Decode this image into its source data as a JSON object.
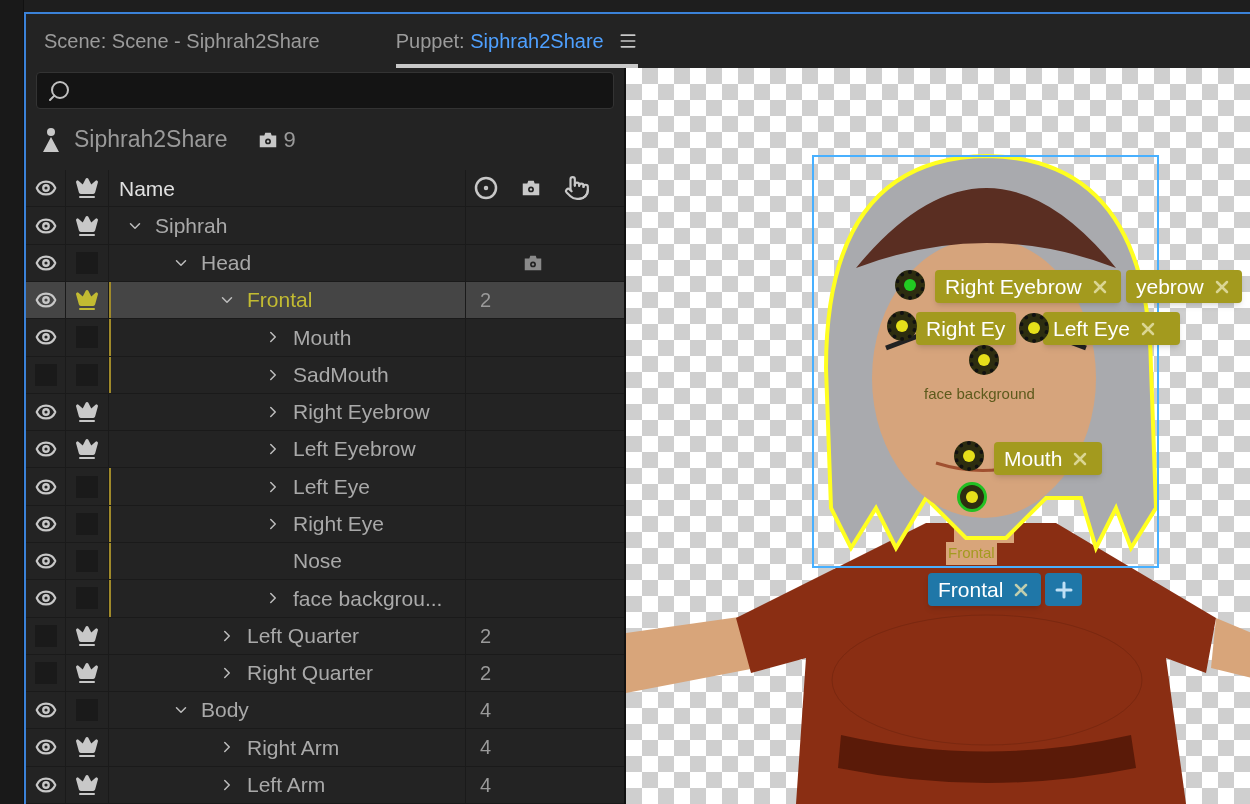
{
  "tabs": [
    {
      "label": "Scene: Scene - Siphrah2Share",
      "selected": false
    },
    {
      "label": "Puppet:",
      "name": "Siphrah2Share",
      "selected": true
    }
  ],
  "puppet": {
    "name": "Siphrah2Share",
    "behavior_count": "9"
  },
  "columns": {
    "name": "Name"
  },
  "tree": [
    {
      "name": "Siphrah",
      "visible": true,
      "crown": true,
      "tagged": false,
      "selected": false,
      "expanded": true,
      "children": [
        {
          "name": "Head",
          "visible": true,
          "crown": false,
          "tagged": false,
          "selected": false,
          "expanded": true,
          "behaviors": true,
          "children": [
            {
              "name": "Frontal",
              "visible": true,
              "crown": true,
              "tagged": true,
              "selected": true,
              "expanded": true,
              "count": "2",
              "children": [
                {
                  "name": "Mouth",
                  "visible": true,
                  "crown": false,
                  "tagged": true,
                  "selected": false,
                  "expanded": false
                },
                {
                  "name": "SadMouth",
                  "visible": false,
                  "crown": false,
                  "tagged": true,
                  "selected": false,
                  "expanded": false
                },
                {
                  "name": "Right Eyebrow",
                  "visible": true,
                  "crown": true,
                  "tagged": false,
                  "selected": false,
                  "expanded": false
                },
                {
                  "name": "Left Eyebrow",
                  "visible": true,
                  "crown": true,
                  "tagged": false,
                  "selected": false,
                  "expanded": false
                },
                {
                  "name": "Left Eye",
                  "visible": true,
                  "crown": false,
                  "tagged": true,
                  "selected": false,
                  "expanded": false
                },
                {
                  "name": "Right Eye",
                  "visible": true,
                  "crown": false,
                  "tagged": true,
                  "selected": false,
                  "expanded": false
                },
                {
                  "name": "Nose",
                  "visible": true,
                  "crown": false,
                  "tagged": true,
                  "selected": false
                },
                {
                  "name": "face backgrou...",
                  "visible": true,
                  "crown": false,
                  "tagged": true,
                  "selected": false,
                  "expanded": false
                }
              ]
            },
            {
              "name": "Left Quarter",
              "visible": false,
              "crown": true,
              "tagged": false,
              "selected": false,
              "expanded": false,
              "count": "2"
            },
            {
              "name": "Right Quarter",
              "visible": false,
              "crown": true,
              "tagged": false,
              "selected": false,
              "expanded": false,
              "count": "2"
            }
          ]
        },
        {
          "name": "Body",
          "visible": true,
          "crown": false,
          "tagged": false,
          "selected": false,
          "expanded": true,
          "count": "4",
          "children": [
            {
              "name": "Right Arm",
              "visible": true,
              "crown": true,
              "tagged": false,
              "selected": false,
              "expanded": false,
              "count": "4"
            },
            {
              "name": "Left Arm",
              "visible": true,
              "crown": true,
              "tagged": false,
              "selected": false,
              "expanded": false,
              "count": "4"
            }
          ]
        }
      ]
    }
  ],
  "canvas": {
    "tags": [
      {
        "label": "Right Eyebrow",
        "closable": true,
        "color": "#a39a1e"
      },
      {
        "label": "yebrow",
        "closable": true,
        "color": "#a39a1e"
      },
      {
        "label": "Right Ey",
        "closable": false,
        "color": "#a39a1e"
      },
      {
        "label": "Left Eye",
        "closable": true,
        "color": "#a39a1e"
      },
      {
        "label": "Mouth",
        "closable": true,
        "color": "#a39a1e"
      },
      {
        "label": "Frontal",
        "closable": true,
        "color": "#1f77a8"
      }
    ],
    "add_button": true,
    "labels": [
      "face background",
      "Frontal"
    ]
  }
}
